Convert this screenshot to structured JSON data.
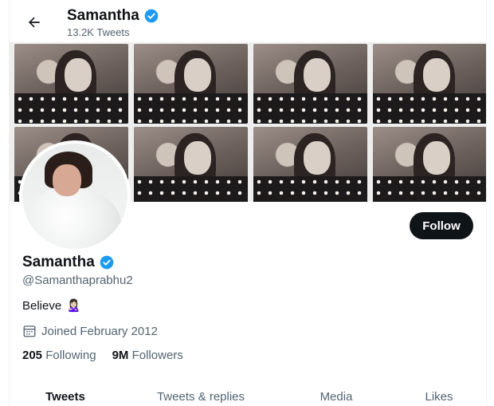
{
  "header": {
    "name": "Samantha",
    "tweet_count": "13.2K Tweets",
    "back_icon": "arrow-left-icon"
  },
  "profile": {
    "name": "Samantha",
    "handle": "@Samanthaprabhu2",
    "bio": "Believe",
    "bio_emoji": "🙎🏻‍♀️",
    "joined": "Joined February 2012",
    "following_count": "205",
    "following_label": "Following",
    "followers_count": "9M",
    "followers_label": "Followers",
    "follow_label": "Follow"
  },
  "tabs": [
    {
      "label": "Tweets",
      "active": true
    },
    {
      "label": "Tweets & replies",
      "active": false
    },
    {
      "label": "Media",
      "active": false
    },
    {
      "label": "Likes",
      "active": false
    }
  ],
  "colors": {
    "verified": "#1d9bf0",
    "muted_text": "#536471",
    "follow_bg": "#0f1419"
  }
}
